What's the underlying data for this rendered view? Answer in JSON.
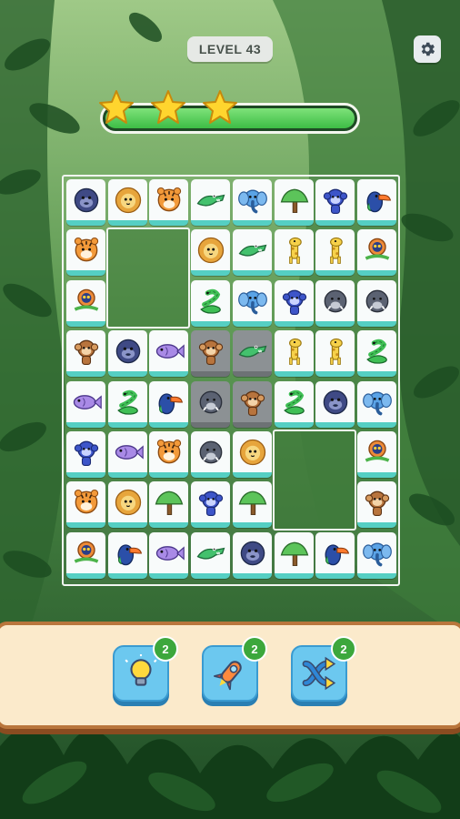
{
  "header": {
    "level_label": "LEVEL 43"
  },
  "progress": {
    "stars_earned": 3,
    "stars_total": 3,
    "fill_fraction": 1.0
  },
  "board": {
    "rows": 8,
    "cols": 8,
    "tiles": [
      [
        "gorilla",
        "lion",
        "tiger",
        "crocodile",
        "elephant",
        "tree",
        "monkey-blue",
        "toucan"
      ],
      [
        "tiger",
        "",
        "",
        "lion",
        "crocodile",
        "giraffe",
        "giraffe",
        "lemur"
      ],
      [
        "lemur",
        "",
        "",
        "snake",
        "elephant",
        "monkey-blue",
        "boar",
        "boar"
      ],
      [
        "monkey",
        "gorilla",
        "fish",
        "monkey",
        "crocodile",
        "giraffe",
        "giraffe",
        "snake"
      ],
      [
        "fish",
        "snake",
        "toucan",
        "boar",
        "monkey",
        "snake",
        "gorilla",
        "elephant"
      ],
      [
        "monkey-blue",
        "fish",
        "tiger",
        "boar",
        "lion",
        "",
        "",
        "lemur"
      ],
      [
        "tiger",
        "lion",
        "tree",
        "monkey-blue",
        "tree",
        "",
        "",
        "monkey"
      ],
      [
        "lemur",
        "toucan",
        "fish",
        "crocodile",
        "gorilla",
        "tree",
        "toucan",
        "elephant"
      ]
    ],
    "selected": [
      [
        3,
        3
      ],
      [
        3,
        4
      ],
      [
        4,
        3
      ],
      [
        4,
        4
      ]
    ]
  },
  "boosters": [
    {
      "name": "hint",
      "icon": "lightbulb-icon",
      "count": "2"
    },
    {
      "name": "bomb",
      "icon": "rocket-icon",
      "count": "2"
    },
    {
      "name": "shuffle",
      "icon": "shuffle-icon",
      "count": "2"
    }
  ],
  "colors": {
    "tile_edge": "#55cfc3",
    "booster_bg": "#6cc8ef",
    "badge": "#3ca73c"
  }
}
